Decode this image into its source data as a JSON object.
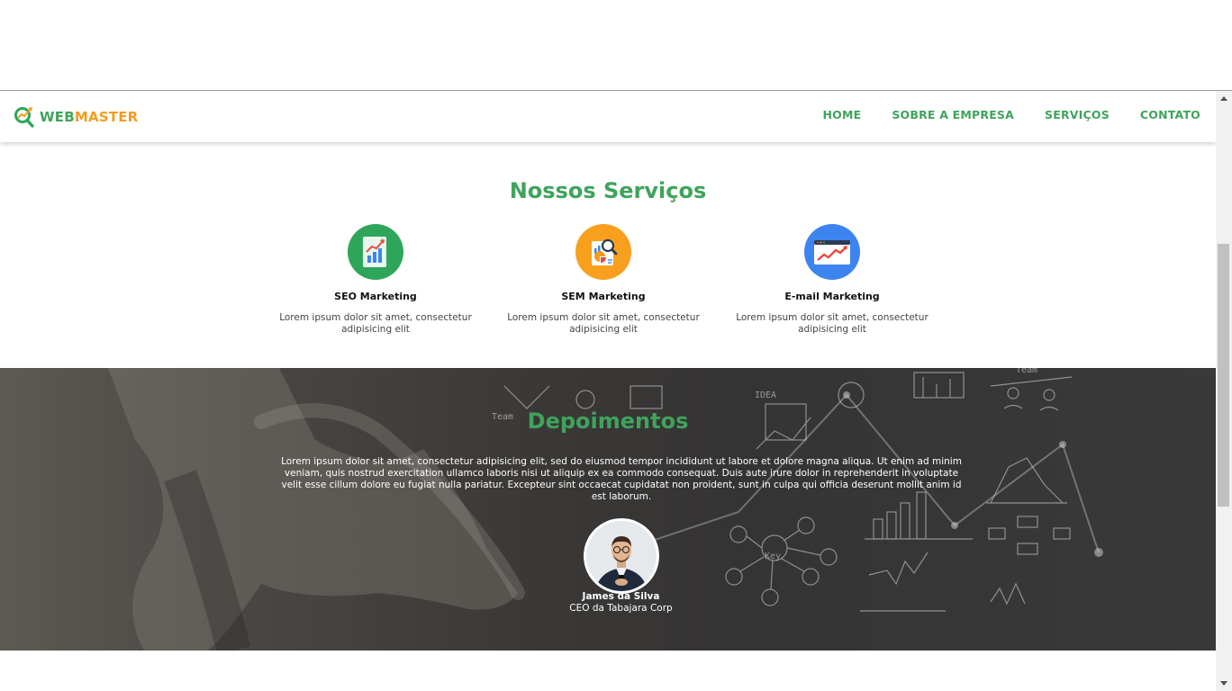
{
  "brand": {
    "name_part1": "WEB",
    "name_part2": "MASTER"
  },
  "nav": {
    "items": [
      {
        "label": "HOME"
      },
      {
        "label": "SOBRE A EMPRESA"
      },
      {
        "label": "SERVIÇOS"
      },
      {
        "label": "CONTATO"
      }
    ]
  },
  "services": {
    "title": "Nossos Serviços",
    "items": [
      {
        "name": "SEO Marketing",
        "desc": "Lorem ipsum dolor sit amet, consectetur adipisicing elit",
        "icon": "seo-chart-icon",
        "color": "#2ea65a"
      },
      {
        "name": "SEM Marketing",
        "desc": "Lorem ipsum dolor sit amet, consectetur adipisicing elit",
        "icon": "analytics-magnifier-icon",
        "color": "#f8a01d"
      },
      {
        "name": "E-mail Marketing",
        "desc": "Lorem ipsum dolor sit amet, consectetur adipisicing elit",
        "icon": "browser-trend-icon",
        "color": "#3d84f0"
      }
    ]
  },
  "testimonials": {
    "title": "Depoimentos",
    "text": "Lorem ipsum dolor sit amet, consectetur adipisicing elit, sed do eiusmod tempor incididunt ut labore et dolore magna aliqua. Ut enim ad minim veniam, quis nostrud exercitation ullamco laboris nisi ut aliquip ex ea commodo consequat. Duis aute irure dolor in reprehenderit in voluptate velit esse cillum dolore eu fugiat nulla pariatur. Excepteur sint occaecat cupidatat non proident, sunt in culpa qui officia deserunt mollit anim id est laborum.",
    "author_name": "James da Silva",
    "author_role": "CEO da Tabajara Corp",
    "sketch_labels": [
      "IDEA",
      "Team",
      "Key",
      "Team"
    ]
  },
  "colors": {
    "accent_green": "#3fa35c",
    "accent_orange": "#f39c1f"
  }
}
